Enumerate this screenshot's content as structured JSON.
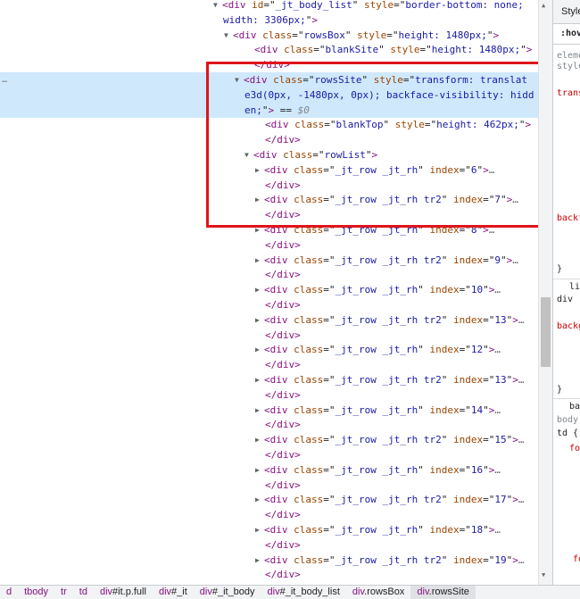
{
  "elements_lines": [
    {
      "indent": 250,
      "tri": "open",
      "parts": [
        [
          "tag",
          "<div "
        ],
        [
          "an",
          "id"
        ],
        [
          "pl",
          "=\""
        ],
        [
          "av",
          "_jt_body_list"
        ],
        [
          "pl",
          "\" "
        ],
        [
          "an",
          "style"
        ],
        [
          "pl",
          "=\""
        ],
        [
          "av",
          "border-bottom: none;"
        ]
      ]
    },
    {
      "indent": 250,
      "tri": "",
      "parts": [
        [
          "av",
          "width: 3306px;"
        ],
        [
          "pl",
          "\""
        ],
        [
          "tag",
          ">"
        ]
      ]
    },
    {
      "indent": 262,
      "tri": "open",
      "parts": [
        [
          "tag",
          "<div "
        ],
        [
          "an",
          "class"
        ],
        [
          "pl",
          "=\""
        ],
        [
          "av",
          "rowsBox"
        ],
        [
          "pl",
          "\" "
        ],
        [
          "an",
          "style"
        ],
        [
          "pl",
          "=\""
        ],
        [
          "av",
          "height: 1480px;"
        ],
        [
          "pl",
          "\""
        ],
        [
          "tag",
          ">"
        ]
      ]
    },
    {
      "indent": 285,
      "tri": "",
      "parts": [
        [
          "tag",
          "<div "
        ],
        [
          "an",
          "class"
        ],
        [
          "pl",
          "=\""
        ],
        [
          "av",
          "blankSite"
        ],
        [
          "pl",
          "\" "
        ],
        [
          "an",
          "style"
        ],
        [
          "pl",
          "=\""
        ],
        [
          "av",
          "height: 1480px;"
        ],
        [
          "pl",
          "\""
        ],
        [
          "tag",
          ">"
        ]
      ]
    },
    {
      "indent": 285,
      "tri": "",
      "parts": [
        [
          "tag",
          "</div>"
        ]
      ]
    },
    {
      "indent": 274,
      "tri": "open",
      "selected": true,
      "parts": [
        [
          "tag",
          "<div "
        ],
        [
          "an",
          "class"
        ],
        [
          "pl",
          "=\""
        ],
        [
          "av",
          "rowsSite"
        ],
        [
          "pl",
          "\" "
        ],
        [
          "an",
          "style"
        ],
        [
          "pl",
          "=\""
        ],
        [
          "av",
          "transform: translat"
        ]
      ]
    },
    {
      "indent": 274,
      "tri": "",
      "selected": true,
      "parts": [
        [
          "av",
          "e3d(0px, -1480px, 0px); backface-visibility: hidd"
        ]
      ]
    },
    {
      "indent": 274,
      "tri": "",
      "selected": true,
      "parts": [
        [
          "av",
          "en;"
        ],
        [
          "pl",
          "\""
        ],
        [
          "tag",
          ">"
        ],
        [
          "pl",
          " == "
        ],
        [
          "dim",
          "$0"
        ]
      ]
    },
    {
      "indent": 297,
      "tri": "",
      "parts": [
        [
          "tag",
          "<div "
        ],
        [
          "an",
          "class"
        ],
        [
          "pl",
          "=\""
        ],
        [
          "av",
          "blankTop"
        ],
        [
          "pl",
          "\" "
        ],
        [
          "an",
          "style"
        ],
        [
          "pl",
          "=\""
        ],
        [
          "av",
          "height: 462px;"
        ],
        [
          "pl",
          "\""
        ],
        [
          "tag",
          ">"
        ]
      ]
    },
    {
      "indent": 297,
      "tri": "",
      "parts": [
        [
          "tag",
          "</div>"
        ]
      ]
    },
    {
      "indent": 285,
      "tri": "open",
      "parts": [
        [
          "tag",
          "<div "
        ],
        [
          "an",
          "class"
        ],
        [
          "pl",
          "=\""
        ],
        [
          "av",
          "rowList"
        ],
        [
          "pl",
          "\""
        ],
        [
          "tag",
          ">"
        ]
      ]
    },
    {
      "indent": 297,
      "tri": "closed",
      "parts": [
        [
          "tag",
          "<div "
        ],
        [
          "an",
          "class"
        ],
        [
          "pl",
          "=\""
        ],
        [
          "av",
          "_jt_row _jt_rh"
        ],
        [
          "pl",
          "\" "
        ],
        [
          "an",
          "index"
        ],
        [
          "pl",
          "=\""
        ],
        [
          "av",
          "6"
        ],
        [
          "pl",
          "\""
        ],
        [
          "tag",
          ">"
        ],
        [
          "ell",
          "…"
        ]
      ]
    },
    {
      "indent": 297,
      "tri": "",
      "parts": [
        [
          "tag",
          "</div>"
        ]
      ]
    },
    {
      "indent": 297,
      "tri": "closed",
      "parts": [
        [
          "tag",
          "<div "
        ],
        [
          "an",
          "class"
        ],
        [
          "pl",
          "=\""
        ],
        [
          "av",
          "_jt_row _jt_rh tr2"
        ],
        [
          "pl",
          "\" "
        ],
        [
          "an",
          "index"
        ],
        [
          "pl",
          "=\""
        ],
        [
          "av",
          "7"
        ],
        [
          "pl",
          "\""
        ],
        [
          "tag",
          ">"
        ],
        [
          "ell",
          "…"
        ]
      ]
    },
    {
      "indent": 297,
      "tri": "",
      "parts": [
        [
          "tag",
          "</div>"
        ]
      ]
    },
    {
      "indent": 297,
      "tri": "closed",
      "parts": [
        [
          "tag",
          "<div "
        ],
        [
          "an",
          "class"
        ],
        [
          "pl",
          "=\""
        ],
        [
          "av",
          "_jt_row _jt_rh"
        ],
        [
          "pl",
          "\" "
        ],
        [
          "an",
          "index"
        ],
        [
          "pl",
          "=\""
        ],
        [
          "av",
          "8"
        ],
        [
          "pl",
          "\""
        ],
        [
          "tag",
          ">"
        ],
        [
          "ell",
          "…"
        ]
      ]
    },
    {
      "indent": 297,
      "tri": "",
      "parts": [
        [
          "tag",
          "</div>"
        ]
      ]
    },
    {
      "indent": 297,
      "tri": "closed",
      "parts": [
        [
          "tag",
          "<div "
        ],
        [
          "an",
          "class"
        ],
        [
          "pl",
          "=\""
        ],
        [
          "av",
          "_jt_row _jt_rh tr2"
        ],
        [
          "pl",
          "\" "
        ],
        [
          "an",
          "index"
        ],
        [
          "pl",
          "=\""
        ],
        [
          "av",
          "9"
        ],
        [
          "pl",
          "\""
        ],
        [
          "tag",
          ">"
        ],
        [
          "ell",
          "…"
        ]
      ]
    },
    {
      "indent": 297,
      "tri": "",
      "parts": [
        [
          "tag",
          "</div>"
        ]
      ]
    },
    {
      "indent": 297,
      "tri": "closed",
      "parts": [
        [
          "tag",
          "<div "
        ],
        [
          "an",
          "class"
        ],
        [
          "pl",
          "=\""
        ],
        [
          "av",
          "_jt_row _jt_rh"
        ],
        [
          "pl",
          "\" "
        ],
        [
          "an",
          "index"
        ],
        [
          "pl",
          "=\""
        ],
        [
          "av",
          "10"
        ],
        [
          "pl",
          "\""
        ],
        [
          "tag",
          ">"
        ],
        [
          "ell",
          "…"
        ]
      ]
    },
    {
      "indent": 297,
      "tri": "",
      "parts": [
        [
          "tag",
          "</div>"
        ]
      ]
    },
    {
      "indent": 297,
      "tri": "closed",
      "parts": [
        [
          "tag",
          "<div "
        ],
        [
          "an",
          "class"
        ],
        [
          "pl",
          "=\""
        ],
        [
          "av",
          "_jt_row _jt_rh tr2"
        ],
        [
          "pl",
          "\" "
        ],
        [
          "an",
          "index"
        ],
        [
          "pl",
          "=\""
        ],
        [
          "av",
          "13"
        ],
        [
          "pl",
          "\""
        ],
        [
          "tag",
          ">"
        ],
        [
          "ell",
          "…"
        ]
      ]
    },
    {
      "indent": 297,
      "tri": "",
      "parts": [
        [
          "tag",
          "</div>"
        ]
      ]
    },
    {
      "indent": 297,
      "tri": "closed",
      "parts": [
        [
          "tag",
          "<div "
        ],
        [
          "an",
          "class"
        ],
        [
          "pl",
          "=\""
        ],
        [
          "av",
          "_jt_row _jt_rh"
        ],
        [
          "pl",
          "\" "
        ],
        [
          "an",
          "index"
        ],
        [
          "pl",
          "=\""
        ],
        [
          "av",
          "12"
        ],
        [
          "pl",
          "\""
        ],
        [
          "tag",
          ">"
        ],
        [
          "ell",
          "…"
        ]
      ]
    },
    {
      "indent": 297,
      "tri": "",
      "parts": [
        [
          "tag",
          "</div>"
        ]
      ]
    },
    {
      "indent": 297,
      "tri": "closed",
      "parts": [
        [
          "tag",
          "<div "
        ],
        [
          "an",
          "class"
        ],
        [
          "pl",
          "=\""
        ],
        [
          "av",
          "_jt_row _jt_rh tr2"
        ],
        [
          "pl",
          "\" "
        ],
        [
          "an",
          "index"
        ],
        [
          "pl",
          "=\""
        ],
        [
          "av",
          "13"
        ],
        [
          "pl",
          "\""
        ],
        [
          "tag",
          ">"
        ],
        [
          "ell",
          "…"
        ]
      ]
    },
    {
      "indent": 297,
      "tri": "",
      "parts": [
        [
          "tag",
          "</div>"
        ]
      ]
    },
    {
      "indent": 297,
      "tri": "closed",
      "parts": [
        [
          "tag",
          "<div "
        ],
        [
          "an",
          "class"
        ],
        [
          "pl",
          "=\""
        ],
        [
          "av",
          "_jt_row _jt_rh"
        ],
        [
          "pl",
          "\" "
        ],
        [
          "an",
          "index"
        ],
        [
          "pl",
          "=\""
        ],
        [
          "av",
          "14"
        ],
        [
          "pl",
          "\""
        ],
        [
          "tag",
          ">"
        ],
        [
          "ell",
          "…"
        ]
      ]
    },
    {
      "indent": 297,
      "tri": "",
      "parts": [
        [
          "tag",
          "</div>"
        ]
      ]
    },
    {
      "indent": 297,
      "tri": "closed",
      "parts": [
        [
          "tag",
          "<div "
        ],
        [
          "an",
          "class"
        ],
        [
          "pl",
          "=\""
        ],
        [
          "av",
          "_jt_row _jt_rh tr2"
        ],
        [
          "pl",
          "\" "
        ],
        [
          "an",
          "index"
        ],
        [
          "pl",
          "=\""
        ],
        [
          "av",
          "15"
        ],
        [
          "pl",
          "\""
        ],
        [
          "tag",
          ">"
        ],
        [
          "ell",
          "…"
        ]
      ]
    },
    {
      "indent": 297,
      "tri": "",
      "parts": [
        [
          "tag",
          "</div>"
        ]
      ]
    },
    {
      "indent": 297,
      "tri": "closed",
      "parts": [
        [
          "tag",
          "<div "
        ],
        [
          "an",
          "class"
        ],
        [
          "pl",
          "=\""
        ],
        [
          "av",
          "_jt_row _jt_rh"
        ],
        [
          "pl",
          "\" "
        ],
        [
          "an",
          "index"
        ],
        [
          "pl",
          "=\""
        ],
        [
          "av",
          "16"
        ],
        [
          "pl",
          "\""
        ],
        [
          "tag",
          ">"
        ],
        [
          "ell",
          "…"
        ]
      ]
    },
    {
      "indent": 297,
      "tri": "",
      "parts": [
        [
          "tag",
          "</div>"
        ]
      ]
    },
    {
      "indent": 297,
      "tri": "closed",
      "parts": [
        [
          "tag",
          "<div "
        ],
        [
          "an",
          "class"
        ],
        [
          "pl",
          "=\""
        ],
        [
          "av",
          "_jt_row _jt_rh tr2"
        ],
        [
          "pl",
          "\" "
        ],
        [
          "an",
          "index"
        ],
        [
          "pl",
          "=\""
        ],
        [
          "av",
          "17"
        ],
        [
          "pl",
          "\""
        ],
        [
          "tag",
          ">"
        ],
        [
          "ell",
          "…"
        ]
      ]
    },
    {
      "indent": 297,
      "tri": "",
      "parts": [
        [
          "tag",
          "</div>"
        ]
      ]
    },
    {
      "indent": 297,
      "tri": "closed",
      "parts": [
        [
          "tag",
          "<div "
        ],
        [
          "an",
          "class"
        ],
        [
          "pl",
          "=\""
        ],
        [
          "av",
          "_jt_row _jt_rh"
        ],
        [
          "pl",
          "\" "
        ],
        [
          "an",
          "index"
        ],
        [
          "pl",
          "=\""
        ],
        [
          "av",
          "18"
        ],
        [
          "pl",
          "\""
        ],
        [
          "tag",
          ">"
        ],
        [
          "ell",
          "…"
        ]
      ]
    },
    {
      "indent": 297,
      "tri": "",
      "parts": [
        [
          "tag",
          "</div>"
        ]
      ]
    },
    {
      "indent": 297,
      "tri": "closed",
      "parts": [
        [
          "tag",
          "<div "
        ],
        [
          "an",
          "class"
        ],
        [
          "pl",
          "=\""
        ],
        [
          "av",
          "_jt_row _jt_rh tr2"
        ],
        [
          "pl",
          "\" "
        ],
        [
          "an",
          "index"
        ],
        [
          "pl",
          "=\""
        ],
        [
          "av",
          "19"
        ],
        [
          "pl",
          "\""
        ],
        [
          "tag",
          ">"
        ],
        [
          "ell",
          "…"
        ]
      ]
    },
    {
      "indent": 297,
      "tri": "",
      "parts": [
        [
          "tag",
          "</div>"
        ]
      ]
    }
  ],
  "selected_row_marker": "…",
  "styles_panel": {
    "tab_label": "Styles",
    "filter_text": ":hov",
    "fragments": [
      {
        "text": "eleme",
        "kind": "gray"
      },
      {
        "text": "style",
        "kind": "gray"
      },
      {
        "text": "trans",
        "kind": "red"
      },
      {
        "text": "backf",
        "kind": "red"
      },
      {
        "text": "}",
        "kind": "sel"
      },
      {
        "text": "li",
        "kind": "sel"
      },
      {
        "text": "div",
        "kind": "sel"
      },
      {
        "text": "backg",
        "kind": "red"
      },
      {
        "text": "}",
        "kind": "sel"
      },
      {
        "text": "ba",
        "kind": "sel"
      },
      {
        "text": "body",
        "kind": "gray"
      },
      {
        "text": "td {",
        "kind": "sel"
      },
      {
        "text": "fo",
        "kind": "red"
      },
      {
        "text": "fo",
        "kind": "red"
      }
    ]
  },
  "breadcrumbs": [
    {
      "tag": "d",
      "cls": ""
    },
    {
      "tag": "tbody",
      "cls": ""
    },
    {
      "tag": "tr",
      "cls": ""
    },
    {
      "tag": "td",
      "cls": ""
    },
    {
      "tag": "div",
      "cls": "#it.p.full"
    },
    {
      "tag": "div",
      "cls": "#_it"
    },
    {
      "tag": "div",
      "cls": "#_it_body"
    },
    {
      "tag": "div",
      "cls": "#_it_body_list"
    },
    {
      "tag": "div",
      "cls": ".rowsBox"
    },
    {
      "tag": "div",
      "cls": ".rowsSite",
      "current": true
    }
  ]
}
